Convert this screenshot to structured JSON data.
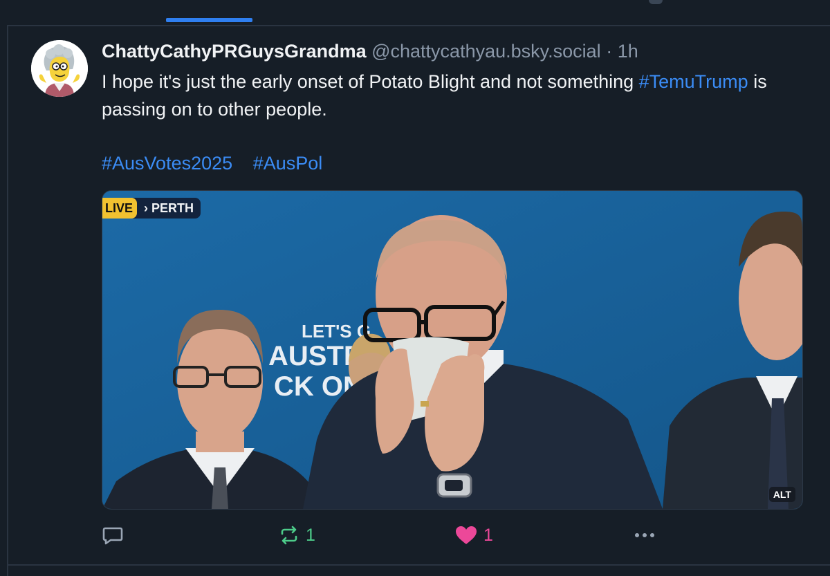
{
  "post": {
    "display_name": "ChattyCathyPRGuysGrandma",
    "handle": "@chattycathyau.bsky.social",
    "separator": "·",
    "time": "1h",
    "text_before": "I hope it's just the early onset of Potato Blight and not something ",
    "text_tag": "#TemuTrump",
    "text_after": " is passing on to other people.",
    "tags": [
      "#AusVotes2025",
      "#AusPol"
    ],
    "media": {
      "live_label": "LIVE",
      "location_label": "PERTH",
      "alt_label": "ALT",
      "backdrop_text": [
        "LET'S G",
        "AUSTR",
        "CK ON 1"
      ]
    },
    "actions": {
      "reply_icon": "speech-bubble-icon",
      "repost_icon": "repost-arrows-icon",
      "repost_count": "1",
      "like_icon": "heart-icon",
      "like_count": "1",
      "more_icon": "ellipsis-icon"
    }
  },
  "colors": {
    "background": "#161e27",
    "accent": "#2f7ff0",
    "link": "#3b8cf5",
    "muted": "#8b98a9",
    "repost": "#4dcc8a",
    "like": "#ec4899"
  }
}
